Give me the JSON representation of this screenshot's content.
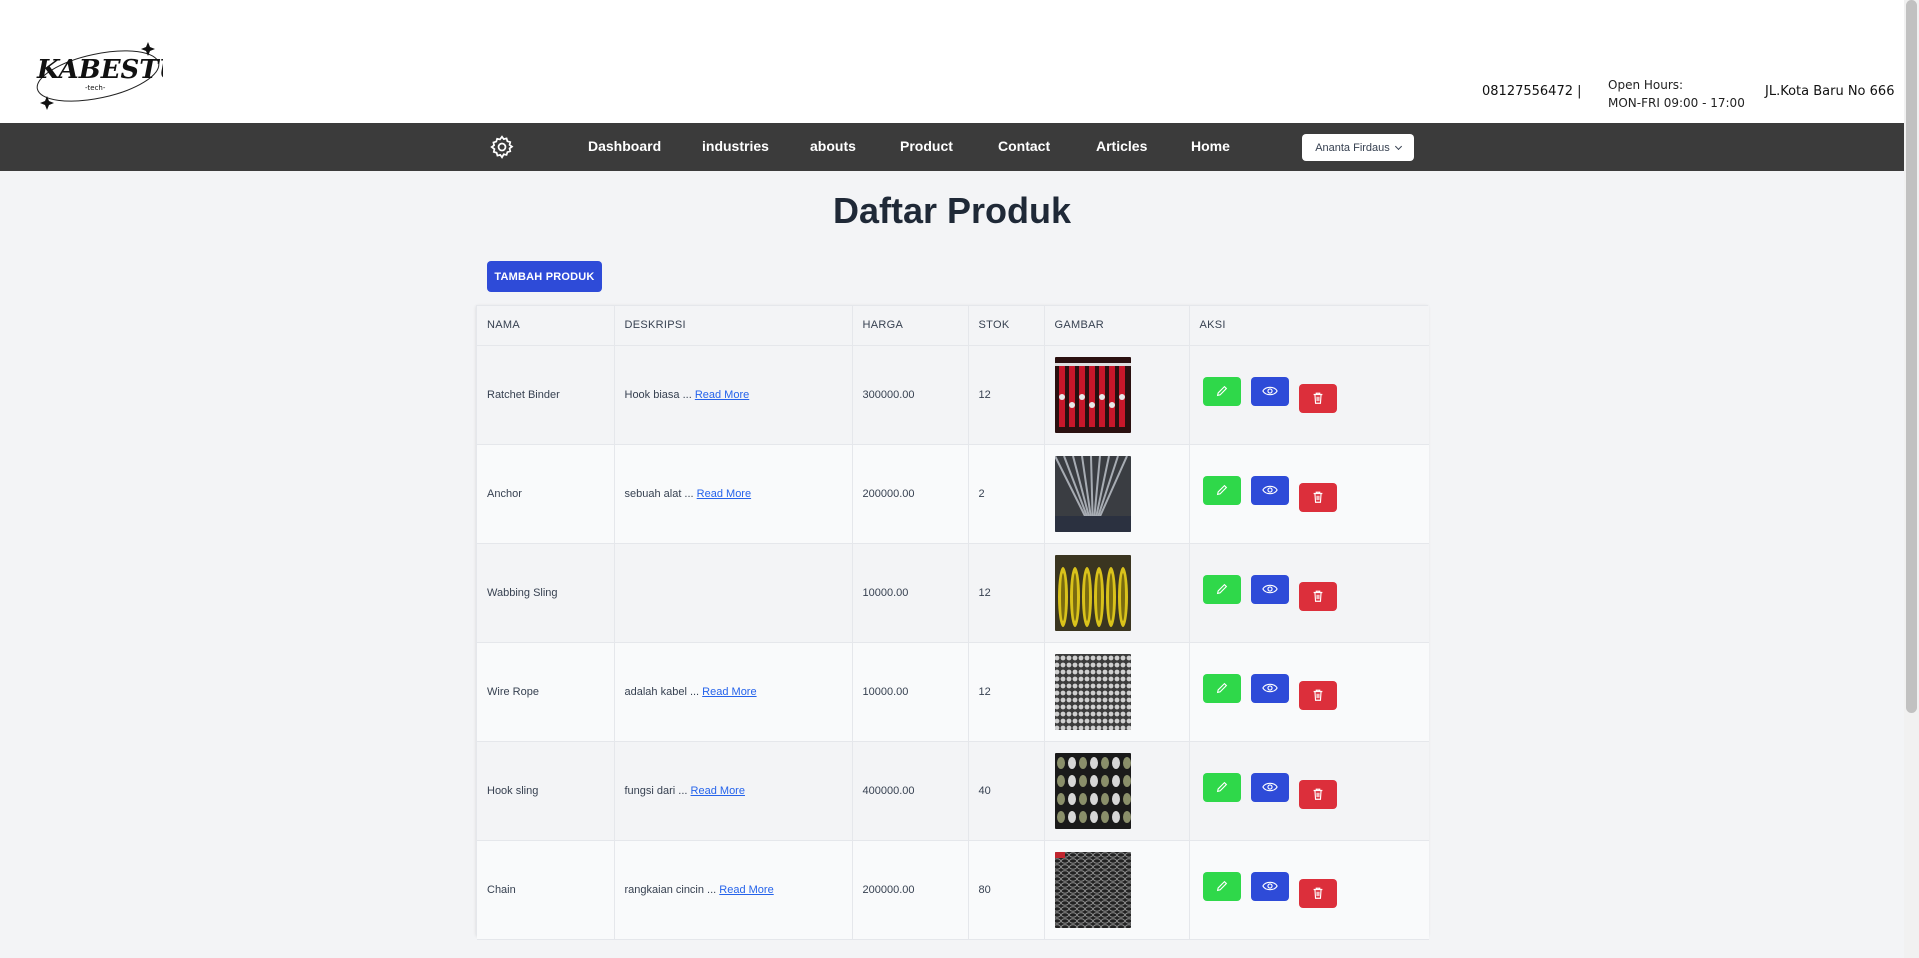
{
  "header": {
    "logo_text": "KABESTU",
    "logo_subtext": "-tech-",
    "phone": "08127556472 |",
    "hours_label": "Open Hours:",
    "hours_value": "MON-FRI 09:00 - 17:00",
    "address": "JL.Kota Baru No 666"
  },
  "nav": {
    "links": [
      "Dashboard",
      "industries",
      "abouts",
      "Product",
      "Contact",
      "Articles",
      "Home"
    ],
    "user": "Ananta Firdaus"
  },
  "page": {
    "title": "Daftar Produk",
    "add_button": "TAMBAH PRODUK"
  },
  "table": {
    "columns": [
      "NAMA",
      "DESKRIPSI",
      "HARGA",
      "STOK",
      "GAMBAR",
      "AKSI"
    ],
    "rows": [
      {
        "nama": "Ratchet Binder",
        "deskripsi": "Hook biasa ... ",
        "read_more": "Read More",
        "harga": "300000.00",
        "stok": "12",
        "image": "red-chain-hooks"
      },
      {
        "nama": "Anchor",
        "deskripsi": "sebuah alat ... ",
        "read_more": "Read More",
        "harga": "200000.00",
        "stok": "2",
        "image": "grey-anchor"
      },
      {
        "nama": "Wabbing Sling",
        "deskripsi": "",
        "read_more": "",
        "harga": "10000.00",
        "stok": "12",
        "image": "yellow-slings"
      },
      {
        "nama": "Wire Rope",
        "deskripsi": "adalah kabel ... ",
        "read_more": "Read More",
        "harga": "10000.00",
        "stok": "12",
        "image": "wire-rope-coil"
      },
      {
        "nama": "Hook sling",
        "deskripsi": "fungsi dari ... ",
        "read_more": "Read More",
        "harga": "400000.00",
        "stok": "40",
        "image": "hook-sling-rack"
      },
      {
        "nama": "Chain",
        "deskripsi": "rangkaian cincin ... ",
        "read_more": "Read More",
        "harga": "200000.00",
        "stok": "80",
        "image": "black-chain"
      }
    ]
  },
  "icons": {
    "settings": "gear-icon",
    "edit": "pencil-icon",
    "view": "eye-icon",
    "delete": "trash-icon"
  },
  "colors": {
    "nav_bg": "#3b3b3b",
    "primary": "#2e4bd8",
    "edit": "#2fd84a",
    "delete": "#dc2f3b",
    "link": "#2563eb"
  }
}
